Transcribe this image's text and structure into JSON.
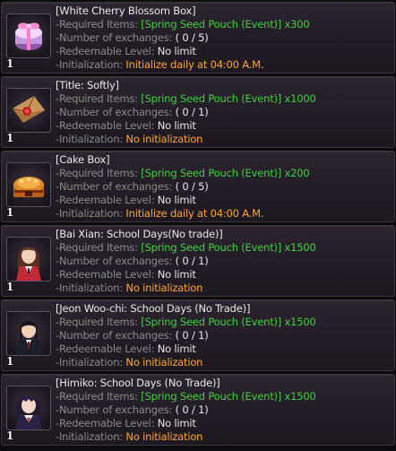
{
  "labels": {
    "required": "-Required Items: ",
    "exchanges": "-Number of exchanges: ",
    "level": "-Redeemable Level: ",
    "init": "-Initialization: "
  },
  "items": [
    {
      "name": "[White Cherry Blossom Box]",
      "required": "[Spring Seed Pouch (Event)] x300",
      "exchanges": "( 0 / 5)",
      "level": "No limit",
      "init": "Initialize daily at 04:00 A.M.",
      "qty": "1",
      "icon": "gift-box-icon"
    },
    {
      "name": "[Title: Softly]",
      "required": "[Spring Seed Pouch (Event)] x1000",
      "exchanges": "( 0 / 1)",
      "level": "No limit",
      "init": "No initialization",
      "qty": "1",
      "icon": "scroll-envelope-icon"
    },
    {
      "name": "[Cake Box]",
      "required": "[Spring Seed Pouch (Event)] x200",
      "exchanges": "( 0 / 5)",
      "level": "No limit",
      "init": "Initialize daily at 04:00 A.M.",
      "qty": "1",
      "icon": "cake-box-icon"
    },
    {
      "name": "[Bai Xian: School Days(No trade)]",
      "required": "[Spring Seed Pouch (Event)] x1500",
      "exchanges": "( 0 / 1)",
      "level": "No limit",
      "init": "No initialization",
      "qty": "1",
      "icon": "costume-portrait-icon"
    },
    {
      "name": "[Jeon Woo-chi: School Days (No Trade)]",
      "required": "[Spring Seed Pouch (Event)] x1500",
      "exchanges": "( 0 / 1)",
      "level": "No limit",
      "init": "No initialization",
      "qty": "1",
      "icon": "costume-portrait-icon"
    },
    {
      "name": "[Himiko: School Days (No Trade)]",
      "required": "[Spring Seed Pouch (Event)] x1500",
      "exchanges": "( 0 / 1)",
      "level": "No limit",
      "init": "No initialization",
      "qty": "1",
      "icon": "costume-portrait-icon"
    }
  ]
}
